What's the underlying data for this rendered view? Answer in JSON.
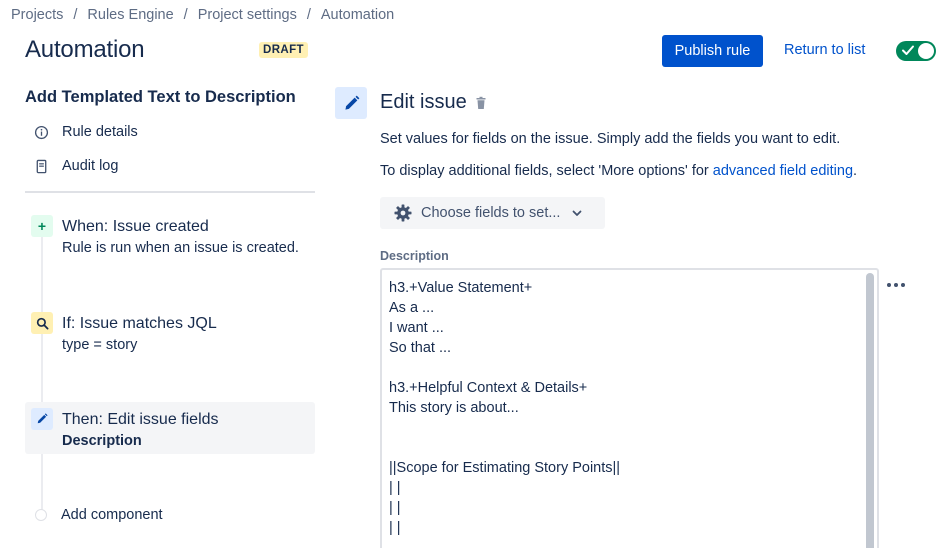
{
  "breadcrumb": [
    "Projects",
    "Rules Engine",
    "Project settings",
    "Automation"
  ],
  "breadcrumb_separator": "/",
  "header": {
    "title": "Automation",
    "status_badge": "DRAFT",
    "publish_label": "Publish rule",
    "return_label": "Return to list",
    "toggle_enabled": true
  },
  "sidebar": {
    "rule_name": "Add Templated Text to Description",
    "links": [
      {
        "label": "Rule details",
        "icon": "info-icon"
      },
      {
        "label": "Audit log",
        "icon": "document-icon"
      }
    ],
    "steps": [
      {
        "title": "When: Issue created",
        "subtitle": "Rule is run when an issue is created.",
        "icon": "plus-icon",
        "color": "#e3fcef"
      },
      {
        "title": "If: Issue matches JQL",
        "subtitle": "type = story",
        "icon": "search-icon",
        "color": "#fff0b3"
      },
      {
        "title": "Then: Edit issue fields",
        "subtitle": "Description",
        "icon": "pencil-icon",
        "color": "#deebff"
      }
    ],
    "add_component_label": "Add component"
  },
  "editor": {
    "title": "Edit issue",
    "description_1": "Set values for fields on the issue. Simply add the fields you want to edit.",
    "description_2_prefix": "To display additional fields, select 'More options' for ",
    "description_2_link": "advanced field editing",
    "description_2_suffix": ".",
    "choose_fields_label": "Choose fields to set...",
    "field_label": "Description",
    "field_value": "h3.+Value Statement+\nAs a ...\nI want ...\nSo that ...\n\nh3.+Helpful Context & Details+\nThis story is about...\n\n\n||Scope for Estimating Story Points||\n| |\n| |\n| |"
  },
  "colors": {
    "primary": "#0052cc",
    "toggle_on": "#00875a",
    "badge_bg": "#fff0b3"
  }
}
